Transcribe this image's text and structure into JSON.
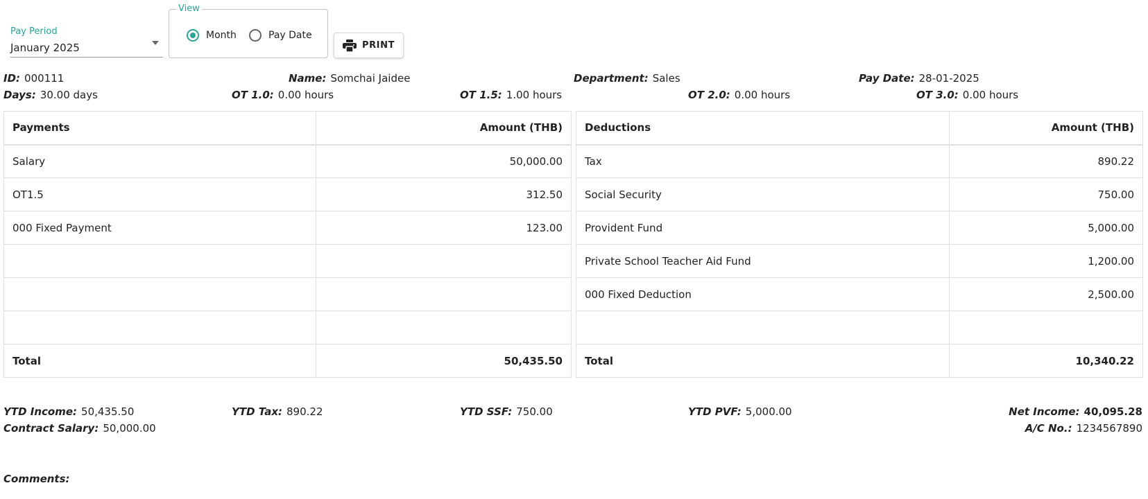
{
  "controls": {
    "pay_period_label": "Pay Period",
    "pay_period_value": "January 2025",
    "view_label": "View",
    "view_options": [
      "Month",
      "Pay Date"
    ],
    "view_selected": "Month",
    "print_label": "PRINT"
  },
  "employee": {
    "id_label": "ID:",
    "id": "000111",
    "name_label": "Name:",
    "name": "Somchai Jaidee",
    "department_label": "Department:",
    "department": "Sales",
    "pay_date_label": "Pay Date:",
    "pay_date": "28-01-2025",
    "days_label": "Days:",
    "days": "30.00  days",
    "ot10_label": "OT 1.0:",
    "ot10": "0.00  hours",
    "ot15_label": "OT 1.5:",
    "ot15": "1.00  hours",
    "ot20_label": "OT 2.0:",
    "ot20": "0.00  hours",
    "ot30_label": "OT 3.0:",
    "ot30": "0.00  hours"
  },
  "payments": {
    "header": "Payments",
    "amount_header": "Amount (THB)",
    "rows": [
      {
        "name": "Salary",
        "amount": "50,000.00"
      },
      {
        "name": "OT1.5",
        "amount": "312.50"
      },
      {
        "name": "000 Fixed Payment",
        "amount": "123.00"
      },
      {
        "name": "",
        "amount": ""
      },
      {
        "name": "",
        "amount": ""
      },
      {
        "name": "",
        "amount": ""
      }
    ],
    "total_label": "Total",
    "total": "50,435.50"
  },
  "deductions": {
    "header": "Deductions",
    "amount_header": "Amount (THB)",
    "rows": [
      {
        "name": "Tax",
        "amount": "890.22"
      },
      {
        "name": "Social Security",
        "amount": "750.00"
      },
      {
        "name": "Provident Fund",
        "amount": "5,000.00"
      },
      {
        "name": "Private School Teacher Aid Fund",
        "amount": "1,200.00"
      },
      {
        "name": "000 Fixed Deduction",
        "amount": "2,500.00"
      },
      {
        "name": "",
        "amount": ""
      }
    ],
    "total_label": "Total",
    "total": "10,340.22"
  },
  "summary": {
    "ytd_income_label": "YTD Income:",
    "ytd_income": "50,435.50",
    "ytd_tax_label": "YTD Tax:",
    "ytd_tax": "890.22",
    "ytd_ssf_label": "YTD SSF:",
    "ytd_ssf": "750.00",
    "ytd_pvf_label": "YTD PVF:",
    "ytd_pvf": "5,000.00",
    "net_income_label": "Net Income:",
    "net_income": "40,095.28",
    "contract_salary_label": "Contract Salary:",
    "contract_salary": "50,000.00",
    "ac_no_label": "A/C No.:",
    "ac_no": "1234567890",
    "comments_label": "Comments:"
  },
  "colors": {
    "accent": "#26a69a"
  }
}
